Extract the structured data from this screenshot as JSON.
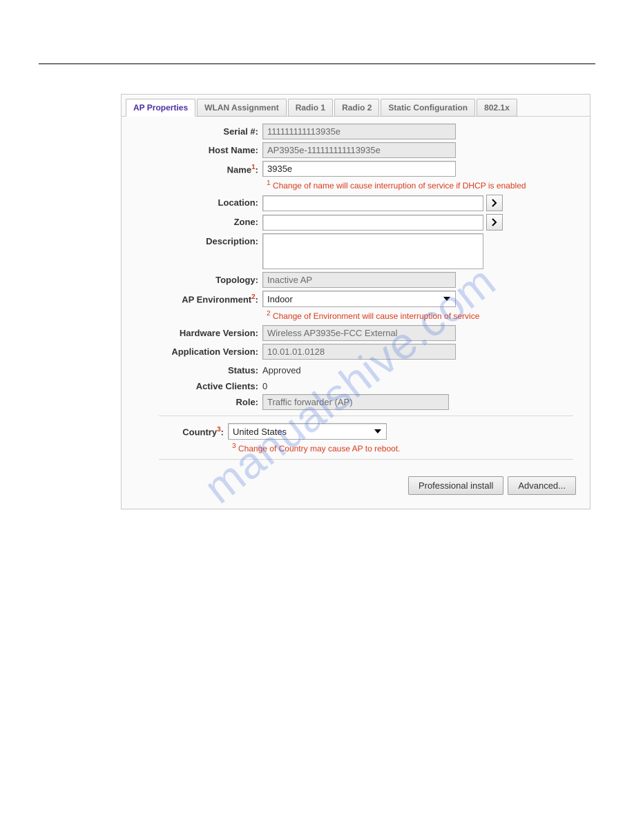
{
  "watermark": "manualshive.com",
  "tabs": {
    "ap_properties": "AP Properties",
    "wlan_assignment": "WLAN Assignment",
    "radio1": "Radio 1",
    "radio2": "Radio 2",
    "static_config": "Static Configuration",
    "dot1x": "802.1x"
  },
  "labels": {
    "serial": "Serial #:",
    "host_name": "Host Name:",
    "name": "Name",
    "name_sup": "1",
    "location": "Location:",
    "zone": "Zone:",
    "description": "Description:",
    "topology": "Topology:",
    "environment": "AP Environment",
    "environment_sup": "2",
    "hw_version": "Hardware Version:",
    "app_version": "Application Version:",
    "status": "Status:",
    "active_clients": "Active Clients:",
    "role": "Role:",
    "country": "Country",
    "country_sup": "3"
  },
  "values": {
    "serial": "111111111113935e",
    "host_name": "AP3935e-111111111113935e",
    "name": "3935e",
    "location": "",
    "zone": "",
    "description": "",
    "topology": "Inactive AP",
    "environment": "Indoor",
    "hw_version": "Wireless AP3935e-FCC External",
    "app_version": "10.01.01.0128",
    "status": "Approved",
    "active_clients": "0",
    "role": "Traffic forwarder (AP)",
    "country": "United States"
  },
  "footnotes": {
    "name": "Change of name will cause interruption of service if DHCP is enabled",
    "name_sup": "1",
    "environment": "Change of Environment will cause interruption of service",
    "environment_sup": "2",
    "country": "Change of Country may cause AP to reboot.",
    "country_sup": "3"
  },
  "buttons": {
    "pro_install": "Professional install",
    "advanced": "Advanced..."
  }
}
